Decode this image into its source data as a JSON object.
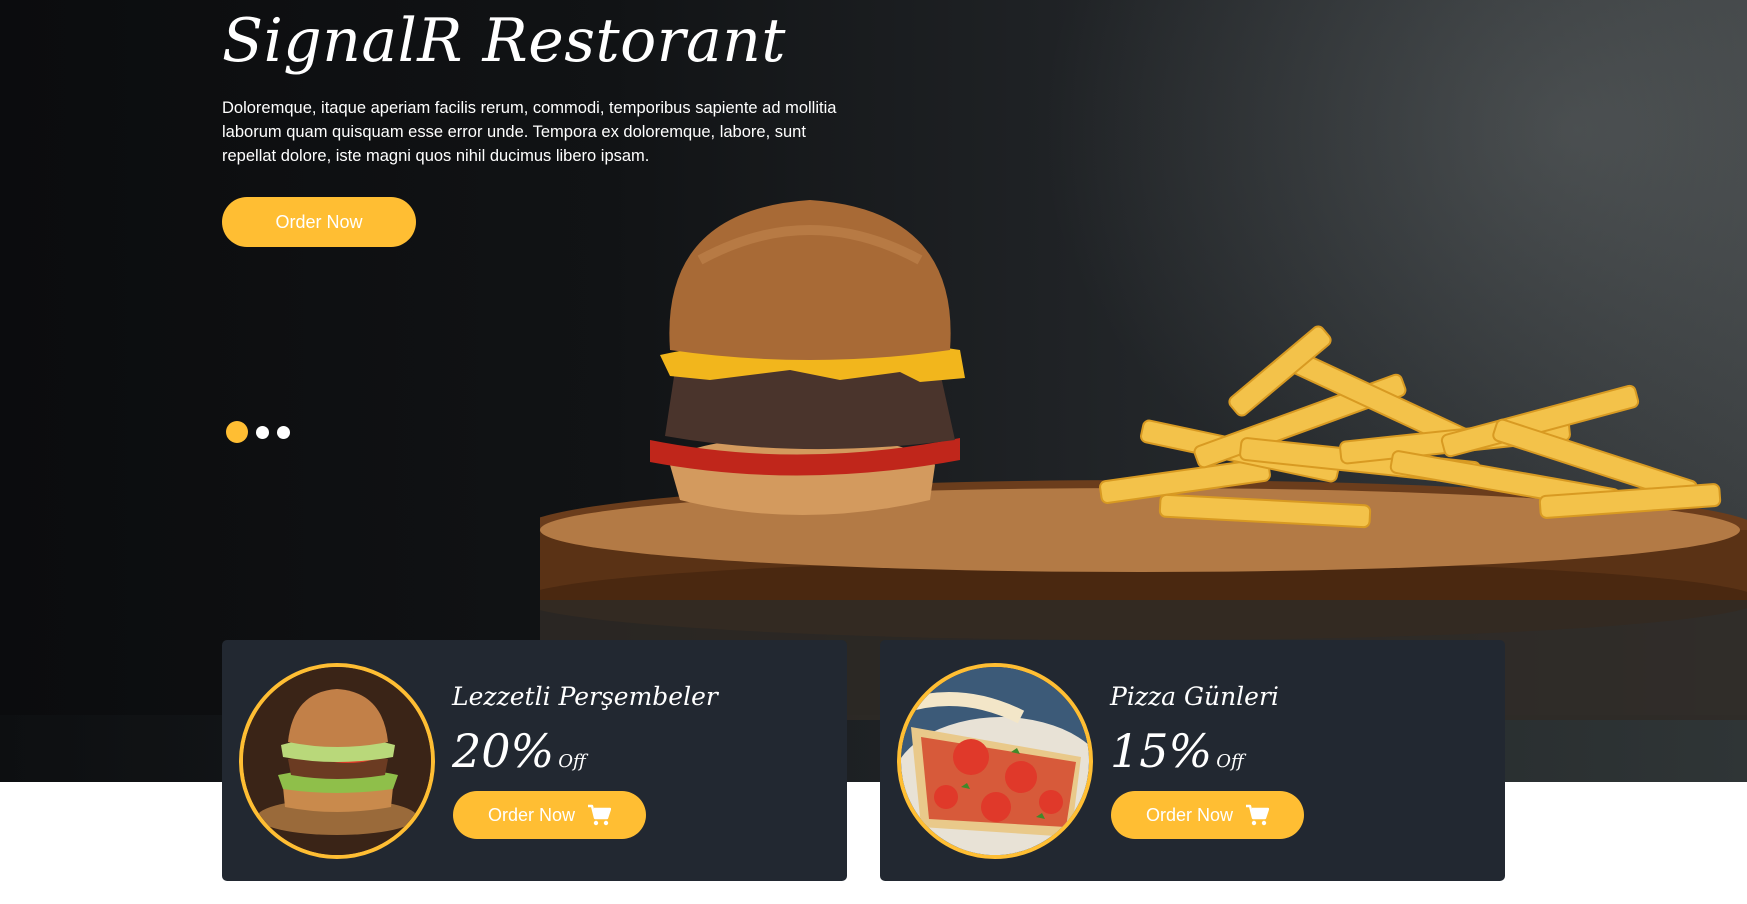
{
  "hero": {
    "brand": "SignalR Restorant",
    "description": "Doloremque, itaque aperiam facilis rerum, commodi, temporibus sapiente ad mollitia laborum quam quisquam esse error unde. Tempora ex doloremque, labore, sunt repellat dolore, iste magni quos nihil ducimus libero ipsam.",
    "order_button": "Order Now",
    "slides": {
      "count": 3,
      "active": 1
    }
  },
  "offers": [
    {
      "title": "Lezzetli Perşembeler",
      "percent": "20%",
      "off_label": "Off",
      "button": "Order Now",
      "image": "burger-image"
    },
    {
      "title": "Pizza Günleri",
      "percent": "15%",
      "off_label": "Off",
      "button": "Order Now",
      "image": "pizza-image"
    }
  ],
  "colors": {
    "accent": "#ffbe33",
    "card_bg": "#222831",
    "hero_bg": "#0b0c0e"
  },
  "icons": [
    "cart-icon"
  ]
}
